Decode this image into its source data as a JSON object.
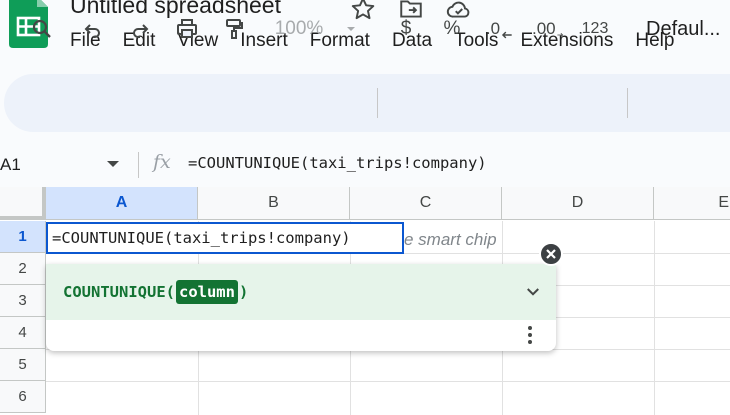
{
  "doc": {
    "title": "Untitled spreadsheet"
  },
  "menu": [
    "File",
    "Edit",
    "View",
    "Insert",
    "Format",
    "Data",
    "Tools",
    "Extensions",
    "Help"
  ],
  "toolbar": {
    "zoom": "100%",
    "currency": "$",
    "percent": "%",
    "decrease_decimal": ".0",
    "increase_decimal": ".00",
    "number_format": "123",
    "font": "Defaul..."
  },
  "formula_bar": {
    "name_box": "A1",
    "fx": "fx",
    "formula": "=COUNTUNIQUE(taxi_trips!company)"
  },
  "grid": {
    "columns": [
      "A",
      "B",
      "C",
      "D",
      "E"
    ],
    "rows": [
      "1",
      "2",
      "3",
      "4",
      "5",
      "6"
    ],
    "active_cell_value": "=COUNTUNIQUE(taxi_trips!company)",
    "overflow_hint": "e smart chip"
  },
  "autocomplete": {
    "function": "COUNTUNIQUE(",
    "argument": "column",
    "close_paren": ")"
  },
  "colors": {
    "accent": "#0b57d0",
    "toolbar_bg": "#edf2fa",
    "suggest_bg": "#e6f4ea",
    "suggest_text": "#137333"
  }
}
